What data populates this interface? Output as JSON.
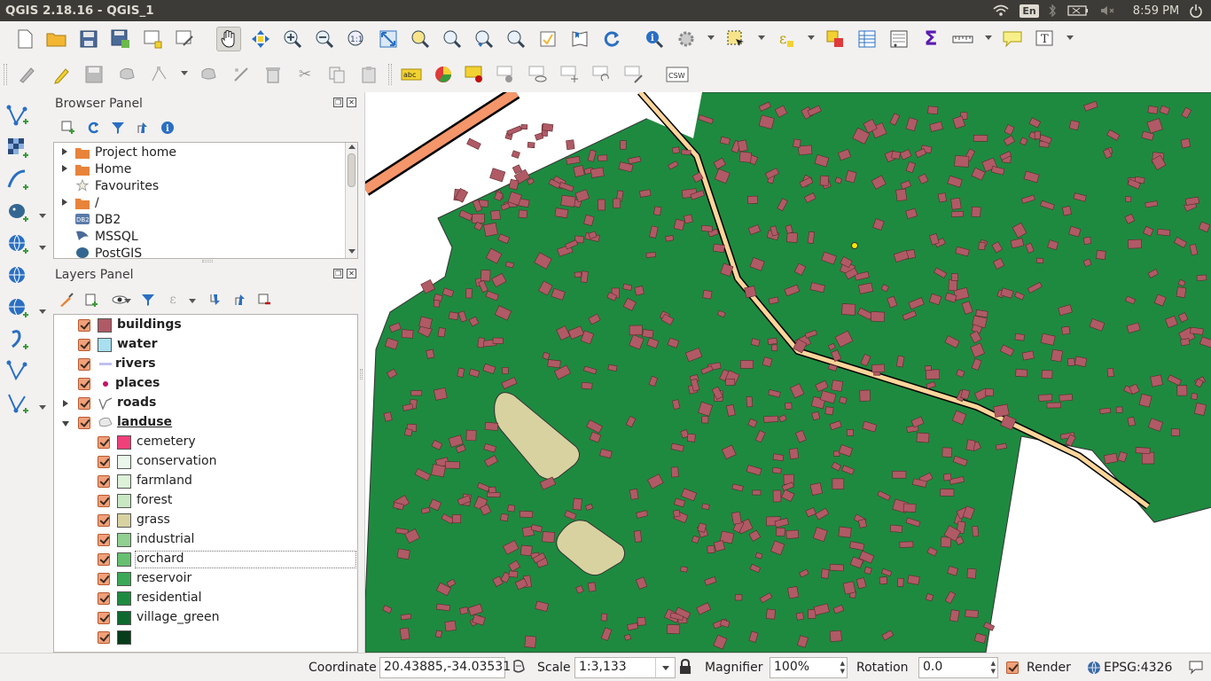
{
  "window": {
    "title": "QGIS 2.18.16 - QGIS_1"
  },
  "tray": {
    "keyboard": "En",
    "time": "8:59 PM",
    "icons": [
      "wifi-icon",
      "bluetooth-icon",
      "battery-icon",
      "volume-icon",
      "power-icon"
    ]
  },
  "toolbar1": {
    "icons": [
      "new-project-icon",
      "open-project-icon",
      "save-project-icon",
      "save-as-icon",
      "new-print-composer-icon",
      "composer-manager-icon",
      "pan-icon",
      "pan-to-selection-icon",
      "zoom-in-icon",
      "zoom-out-icon",
      "zoom-native-icon",
      "zoom-full-icon",
      "zoom-to-selection-icon",
      "zoom-to-layer-icon",
      "zoom-last-icon",
      "zoom-next-icon",
      "new-bookmark-icon",
      "show-bookmarks-icon",
      "refresh-icon",
      "identify-icon",
      "action-icon",
      "select-features-icon",
      "select-by-expression-icon",
      "deselect-icon",
      "attribute-table-icon",
      "field-calculator-icon",
      "statistics-icon",
      "measure-icon",
      "map-tips-icon",
      "text-annotation-icon"
    ]
  },
  "toolbar2": {
    "csw_label": "CSW",
    "abc_label": "abc"
  },
  "browser": {
    "title": "Browser Panel",
    "items": [
      {
        "label": "Project home",
        "icon": "folder-icon",
        "expandable": true
      },
      {
        "label": "Home",
        "icon": "folder-icon",
        "expandable": true
      },
      {
        "label": "Favourites",
        "icon": "star-icon",
        "expandable": false
      },
      {
        "label": "/",
        "icon": "folder-icon",
        "expandable": true
      },
      {
        "label": "DB2",
        "icon": "db2-icon",
        "expandable": false
      },
      {
        "label": "MSSQL",
        "icon": "mssql-icon",
        "expandable": false
      },
      {
        "label": "PostGIS",
        "icon": "postgis-icon",
        "expandable": false
      }
    ]
  },
  "layers": {
    "title": "Layers Panel",
    "items": [
      {
        "label": "buildings",
        "bold": true,
        "symbol": "fill",
        "color": "#b05a66",
        "indent": 0,
        "expandable": false
      },
      {
        "label": "water",
        "bold": true,
        "symbol": "fill",
        "color": "#a8e0f0",
        "indent": 0,
        "expandable": false
      },
      {
        "label": "rivers",
        "bold": true,
        "symbol": "line",
        "color": "#c0c0f0",
        "indent": 0,
        "expandable": false
      },
      {
        "label": "places",
        "bold": true,
        "symbol": "point",
        "color": "#c8106a",
        "indent": 0,
        "expandable": false
      },
      {
        "label": "roads",
        "bold": true,
        "symbol": "lines",
        "color": "#777777",
        "indent": 0,
        "expandable": true
      },
      {
        "label": "landuse",
        "bold": true,
        "symbol": "polygons",
        "color": "#999999",
        "indent": 0,
        "expandable": true,
        "expanded": true,
        "underlined": true
      },
      {
        "label": "cemetery",
        "bold": false,
        "symbol": "fill",
        "color": "#f0407a",
        "indent": 1
      },
      {
        "label": "conservation",
        "bold": false,
        "symbol": "fill",
        "color": "#eaf6ea",
        "indent": 1
      },
      {
        "label": "farmland",
        "bold": false,
        "symbol": "fill",
        "color": "#ddf0d8",
        "indent": 1
      },
      {
        "label": "forest",
        "bold": false,
        "symbol": "fill",
        "color": "#c8e8c2",
        "indent": 1
      },
      {
        "label": "grass",
        "bold": false,
        "symbol": "fill",
        "color": "#d8d2a0",
        "indent": 1
      },
      {
        "label": "industrial",
        "bold": false,
        "symbol": "fill",
        "color": "#90d090",
        "indent": 1
      },
      {
        "label": "orchard",
        "bold": false,
        "symbol": "fill",
        "color": "#66c070",
        "indent": 1,
        "focused": true
      },
      {
        "label": "reservoir",
        "bold": false,
        "symbol": "fill",
        "color": "#3aa856",
        "indent": 1
      },
      {
        "label": "residential",
        "bold": false,
        "symbol": "fill",
        "color": "#1e8a40",
        "indent": 1
      },
      {
        "label": "village_green",
        "bold": false,
        "symbol": "fill",
        "color": "#0d6a2e",
        "indent": 1
      },
      {
        "label": "",
        "bold": false,
        "symbol": "fill",
        "color": "#073d1a",
        "indent": 1
      }
    ]
  },
  "status": {
    "coordinate_label": "Coordinate",
    "coordinate_value": "20.43885,-34.03531",
    "scale_label": "Scale",
    "scale_value": "1:3,133",
    "magnifier_label": "Magnifier",
    "magnifier_value": "100%",
    "rotation_label": "Rotation",
    "rotation_value": "0.0",
    "render_label": "Render",
    "crs_label": "EPSG:4326"
  },
  "colors": {
    "residential": "#1e8a40",
    "buildings": "#b05a66",
    "grass": "#d8d2a0",
    "road_casing": "#000000",
    "road_fill": "#fdd59a",
    "primary_road": "#f4956a"
  }
}
